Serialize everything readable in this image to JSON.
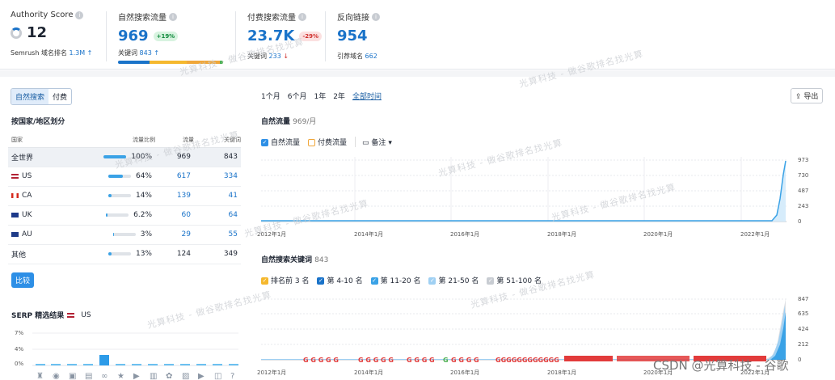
{
  "metrics": {
    "authority": {
      "label": "Authority Score",
      "value": "12",
      "sub_label": "Semrush 域名排名",
      "sub_value": "1.3M",
      "sub_arrow": "↑"
    },
    "organic": {
      "label": "自然搜索流量",
      "value": "969",
      "change": "+19%",
      "sub_label": "关键词",
      "sub_value": "843",
      "sub_arrow": "↑"
    },
    "paid": {
      "label": "付费搜索流量",
      "value": "23.7K",
      "change": "-29%",
      "sub_label": "关键词",
      "sub_value": "233",
      "sub_arrow": "↓"
    },
    "backlinks": {
      "label": "反向链接",
      "value": "954",
      "sub_label": "引荐域名",
      "sub_value": "662"
    }
  },
  "watermark": "光算科技 - 做谷歌排名找光算",
  "tabs": [
    "自然搜索",
    "付费"
  ],
  "country_section": {
    "title": "按国家/地区划分",
    "headers": [
      "国家",
      "流量比例",
      "流量",
      "关键词"
    ],
    "rows": [
      {
        "name": "全世界",
        "share": "100%",
        "share_value": 100,
        "traffic": "969",
        "keywords": "843"
      },
      {
        "name": "US",
        "share": "64%",
        "share_value": 64,
        "traffic": "617",
        "keywords": "334"
      },
      {
        "name": "CA",
        "share": "14%",
        "share_value": 14,
        "traffic": "139",
        "keywords": "41"
      },
      {
        "name": "UK",
        "share": "6.2%",
        "share_value": 6.2,
        "traffic": "60",
        "keywords": "64"
      },
      {
        "name": "AU",
        "share": "3%",
        "share_value": 3,
        "traffic": "29",
        "keywords": "55"
      },
      {
        "name": "其他",
        "share": "13%",
        "share_value": 13,
        "traffic": "124",
        "keywords": "349"
      }
    ],
    "compare_button": "比较"
  },
  "serp": {
    "title": "SERP 精选结果",
    "country": "US",
    "yticks": [
      "7%",
      "4%",
      "0%"
    ]
  },
  "time_filters": [
    "1个月",
    "6个月",
    "1年",
    "2年",
    "全部时间"
  ],
  "export_label": "导出",
  "traffic_chart": {
    "title": "自然流量",
    "subtitle": "969/月",
    "legend": [
      "自然流量",
      "付费流量",
      "备注"
    ],
    "yticks": [
      "973",
      "730",
      "487",
      "243",
      "0"
    ],
    "xticks": [
      "2012年1月",
      "2014年1月",
      "2016年1月",
      "2018年1月",
      "2020年1月",
      "2022年1月"
    ]
  },
  "keywords_chart": {
    "title": "自然搜索关键词",
    "count": "843",
    "legend": [
      "排名前 3 名",
      "第 4-10 名",
      "第 11-20 名",
      "第 21-50 名",
      "第 51-100 名"
    ],
    "yticks": [
      "847",
      "635",
      "424",
      "212",
      "0"
    ],
    "xticks": [
      "2012年1月",
      "2014年1月",
      "2016年1月",
      "2018年1月",
      "2020年1月",
      "2022年1月"
    ]
  },
  "csdn_watermark": "CSDN @光算科技 - 谷歌",
  "colors": {
    "accent": "#1a73c9",
    "green": "#0f8a3c",
    "red": "#d0302e",
    "line": "#3aa2e6"
  },
  "chart_data": [
    {
      "type": "line",
      "title": "自然流量",
      "x": [
        "2012-01",
        "2014-01",
        "2016-01",
        "2018-01",
        "2020-01",
        "2022-01",
        "2022-06",
        "2022-09",
        "2022-12"
      ],
      "series": [
        {
          "name": "自然流量",
          "values": [
            0,
            0,
            0,
            0,
            0,
            0,
            20,
            500,
            969
          ]
        }
      ],
      "ylim": [
        0,
        973
      ]
    },
    {
      "type": "area",
      "title": "自然搜索关键词",
      "x": [
        "2012-01",
        "2014-01",
        "2016-01",
        "2018-01",
        "2020-01",
        "2022-01",
        "2022-06",
        "2022-09",
        "2022-12"
      ],
      "series": [
        {
          "name": "自然搜索关键词",
          "values": [
            0,
            0,
            0,
            0,
            0,
            0,
            30,
            420,
            843
          ]
        }
      ],
      "ylim": [
        0,
        847
      ]
    }
  ]
}
